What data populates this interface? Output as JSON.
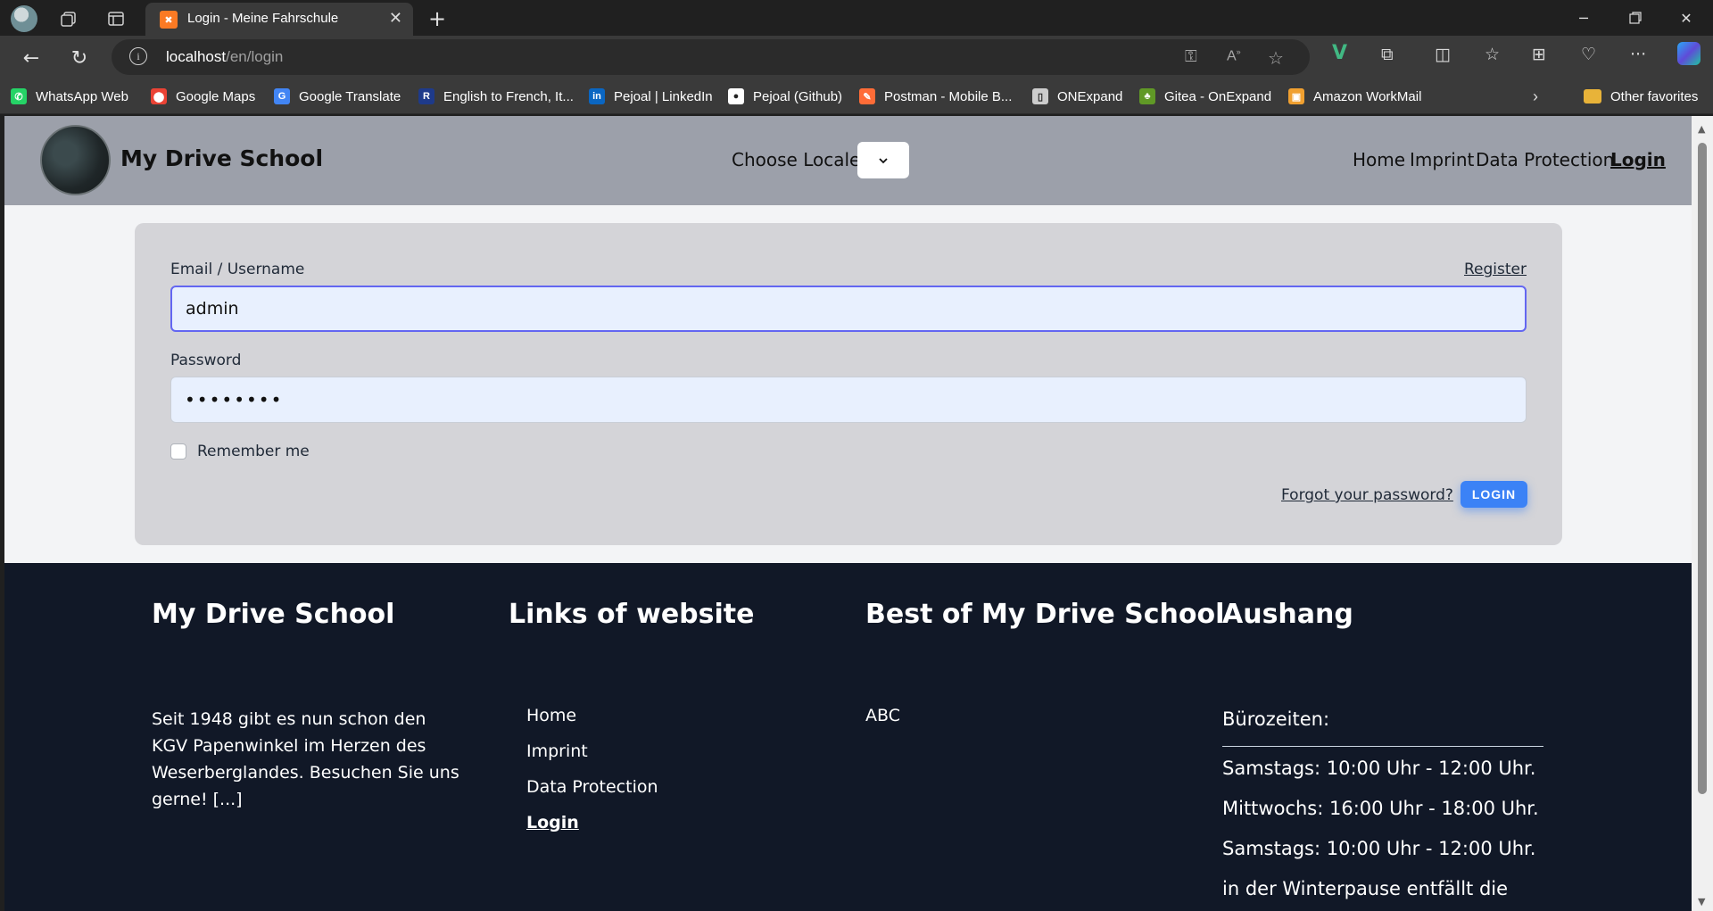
{
  "browser": {
    "tab_title": "Login - Meine Fahrschule",
    "url_host": "localhost",
    "url_path": "/en/login",
    "bookmarks": [
      {
        "label": "WhatsApp Web",
        "icon": "whatsapp-icon",
        "color": "#25d366"
      },
      {
        "label": "Google Maps",
        "icon": "google-maps-icon",
        "color": "#ea4335"
      },
      {
        "label": "Google Translate",
        "icon": "google-translate-icon",
        "color": "#4285f4"
      },
      {
        "label": "English to French, It...",
        "icon": "reverso-icon",
        "color": "#1e3a8a"
      },
      {
        "label": "Pejoal | LinkedIn",
        "icon": "linkedin-icon",
        "color": "#0a66c2"
      },
      {
        "label": "Pejoal (Github)",
        "icon": "github-icon",
        "color": "#ffffff"
      },
      {
        "label": "Postman - Mobile B...",
        "icon": "postman-icon",
        "color": "#ff6c37"
      },
      {
        "label": "ONExpand",
        "icon": "document-icon",
        "color": "#cccccc"
      },
      {
        "label": "Gitea - OnExpand",
        "icon": "gitea-icon",
        "color": "#609926"
      },
      {
        "label": "Amazon WorkMail",
        "icon": "amazon-workmail-icon",
        "color": "#f0a030"
      }
    ],
    "other_favorites": "Other favorites"
  },
  "header": {
    "brand": "My Drive School",
    "locale_label": "Choose Locale",
    "nav": [
      {
        "label": "Home",
        "active": false
      },
      {
        "label": "Imprint",
        "active": false
      },
      {
        "label": "Data Protection",
        "active": false
      },
      {
        "label": "Login",
        "active": true
      }
    ]
  },
  "login": {
    "email_label": "Email / Username",
    "register_label": "Register",
    "email_value": "admin",
    "password_label": "Password",
    "password_value": "••••••••",
    "remember_label": "Remember me",
    "remember_checked": false,
    "forgot_label": "Forgot your password?",
    "login_button": "LOGIN",
    "accent_color": "#3b82f6"
  },
  "footer": {
    "col1_title": "My Drive School",
    "col1_text": "Seit 1948 gibt es nun schon den KGV Papenwinkel im Herzen des Weserberglandes. Besuchen Sie uns gerne! [...]",
    "col2_title": "Links of website",
    "links": [
      {
        "label": "Home",
        "active": false
      },
      {
        "label": "Imprint",
        "active": false
      },
      {
        "label": "Data Protection",
        "active": false
      },
      {
        "label": "Login",
        "active": true
      }
    ],
    "col3_title": "Best of My Drive School",
    "best": "ABC",
    "col4_title": "Aushang",
    "office_heading": "Bürozeiten:",
    "office_lines": [
      "Samstags: 10:00 Uhr - 12:00 Uhr.",
      "Mittwochs: 16:00 Uhr - 18:00 Uhr.",
      "Samstags: 10:00 Uhr - 12:00 Uhr.",
      "in der Winterpause entfällt die"
    ]
  }
}
